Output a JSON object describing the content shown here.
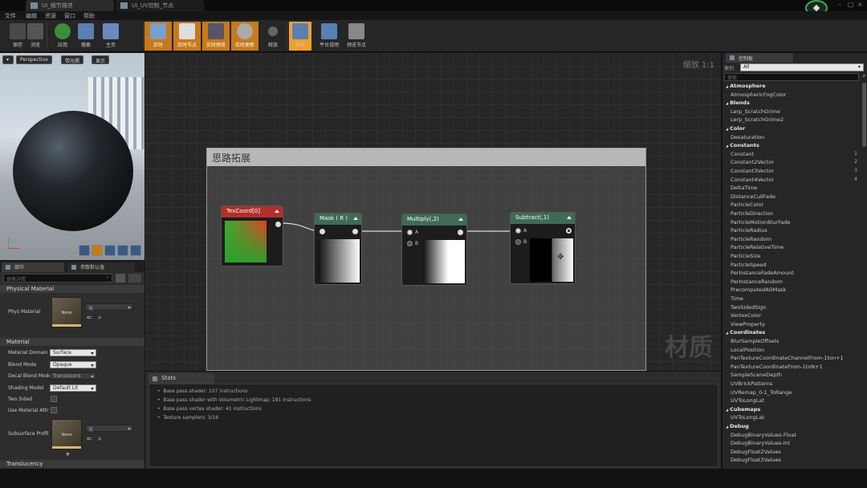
{
  "window": {
    "tabs": [
      "UI_细节描述",
      "UI_UV控制_节点"
    ],
    "menu": [
      "文件",
      "编辑",
      "资源",
      "窗口",
      "帮助"
    ],
    "window_controls": [
      "–",
      "□",
      "×"
    ]
  },
  "toolbar": {
    "buttons": [
      "保存",
      "浏览",
      "应用",
      "搜索",
      "主页",
      "实时",
      "实时节点",
      "实时预览",
      "实时更新",
      "释放",
      "节点",
      "平台说明",
      "预览节点"
    ]
  },
  "viewport": {
    "perspective": "Perspective",
    "lit": "带光照",
    "show": "显示"
  },
  "details": {
    "tabs": [
      "细节",
      "参数默认值"
    ],
    "search_placeholder": "搜索详情",
    "sections": {
      "physical": "Physical Material",
      "material": "Material",
      "translucency": "Translucency"
    },
    "phys_material_label": "Phys Material",
    "phys_material_value": "无",
    "thumb_none": "None",
    "props": [
      {
        "label": "Material Domain",
        "value": "Surface"
      },
      {
        "label": "Blend Mode",
        "value": "Opaque"
      },
      {
        "label": "Decal Blend Mode",
        "value": "Translucent"
      },
      {
        "label": "Shading Model",
        "value": "Default Lit"
      },
      {
        "label": "Two Sided",
        "value": ""
      },
      {
        "label": "Use Material Attr",
        "value": ""
      },
      {
        "label": "Subsurface Profil",
        "value": "无"
      }
    ]
  },
  "graph": {
    "zoom": "缩放 1:1",
    "comment": "思路拓展",
    "watermark": "材质",
    "nodes": [
      {
        "title": "TexCoord[0]",
        "color": "#b0302b"
      },
      {
        "title": "Mask ( R )",
        "color": "#3f6b55"
      },
      {
        "title": "Multiply(,2)",
        "color": "#3f6b55"
      },
      {
        "title": "Subtract(,1)",
        "color": "#3f6b55"
      }
    ],
    "pin_a": "A",
    "pin_b": "B"
  },
  "stats": {
    "tab": "Stats",
    "lines": [
      "Base pass shader: 107 instructions",
      "Base pass shader with Volumetric Lightmap: 181 instructions",
      "Base pass vertex shader: 41 instructions",
      "Texture samplers: 3/16"
    ]
  },
  "palette": {
    "tab": "控制板",
    "category_label": "类别",
    "category_value": "All",
    "search_placeholder": "搜索",
    "items": [
      {
        "text": "Atmosphere",
        "cat": true
      },
      {
        "text": "AtmosphericFogColor"
      },
      {
        "text": "Blends",
        "cat": true
      },
      {
        "text": "Lerp_ScratchGrime"
      },
      {
        "text": "Lerp_ScratchGrime2"
      },
      {
        "text": "Color",
        "cat": true
      },
      {
        "text": "Desaturation"
      },
      {
        "text": "Constants",
        "cat": true
      },
      {
        "text": "Constant",
        "num": "1"
      },
      {
        "text": "Constant2Vector",
        "num": "2"
      },
      {
        "text": "Constant3Vector",
        "num": "3"
      },
      {
        "text": "Constant4Vector",
        "num": "4"
      },
      {
        "text": "DeltaTime"
      },
      {
        "text": "DistanceCullFade"
      },
      {
        "text": "ParticleColor"
      },
      {
        "text": "ParticleDirection"
      },
      {
        "text": "ParticleMotionBlurFade"
      },
      {
        "text": "ParticleRadius"
      },
      {
        "text": "ParticleRandom"
      },
      {
        "text": "ParticleRelativeTime"
      },
      {
        "text": "ParticleSize"
      },
      {
        "text": "ParticleSpeed"
      },
      {
        "text": "PerInstanceFadeAmount"
      },
      {
        "text": "PerInstanceRandom"
      },
      {
        "text": "PrecomputedAOMask"
      },
      {
        "text": "Time"
      },
      {
        "text": "TwoSidedSign"
      },
      {
        "text": "VertexColor"
      },
      {
        "text": "ViewProperty"
      },
      {
        "text": "Coordinates",
        "cat": true
      },
      {
        "text": "BlurSampleOffsets"
      },
      {
        "text": "LocalPosition"
      },
      {
        "text": "PanTextureCoordinateChannelFrom-1ton+1"
      },
      {
        "text": "PanTextureCoordinateFrom-1toN+1"
      },
      {
        "text": "SampleSceneDepth"
      },
      {
        "text": "UVBrickPatterns"
      },
      {
        "text": "UVRemap_0-1_ToRange"
      },
      {
        "text": "UVToLongLat"
      },
      {
        "text": "Cubemaps",
        "cat": true
      },
      {
        "text": "UVToLongLat"
      },
      {
        "text": "Debug",
        "cat": true
      },
      {
        "text": "DebugBinaryValues-Float"
      },
      {
        "text": "DebugBinaryValues-Int"
      },
      {
        "text": "DebugFloat2Values"
      },
      {
        "text": "DebugFloat3Values"
      }
    ]
  }
}
